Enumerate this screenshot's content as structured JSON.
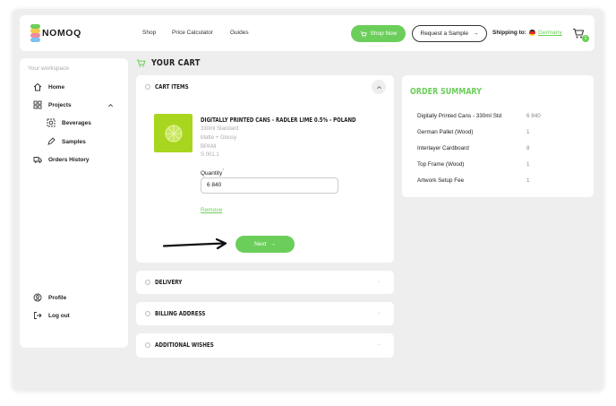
{
  "brand": {
    "name": "NOMOQ"
  },
  "header": {
    "nav": [
      "Shop",
      "Price Calculator",
      "Guides"
    ],
    "shop_now_label": "Shop Now",
    "request_sample_label": "Request a Sample",
    "shipping_label": "Shipping to:",
    "shipping_country": "Germany",
    "cart_count": "1"
  },
  "sidebar": {
    "workspace_label": "Your workspace",
    "items": [
      {
        "label": "Home",
        "icon": "home-icon"
      },
      {
        "label": "Projects",
        "icon": "grid-icon"
      },
      {
        "label": "Beverages",
        "icon": "can-icon"
      },
      {
        "label": "Samples",
        "icon": "pen-icon"
      },
      {
        "label": "Orders History",
        "icon": "truck-icon"
      }
    ],
    "bottom": [
      {
        "label": "Profile",
        "icon": "user-icon"
      },
      {
        "label": "Log out",
        "icon": "logout-icon"
      }
    ]
  },
  "page": {
    "title": "YOUR CART"
  },
  "cart_items": {
    "heading": "CART ITEMS",
    "product": {
      "title": "DIGITALLY PRINTED CANS - RADLER LIME 0.5% - POLAND",
      "lines": [
        "330ml Standard",
        "Matte + Glossy",
        "BPANI",
        "S 001.1"
      ]
    },
    "quantity_label": "Quantity",
    "quantity_value": "6 840",
    "remove_label": "Remove",
    "next_label": "Next"
  },
  "sections": [
    {
      "heading": "DELIVERY"
    },
    {
      "heading": "BILLING ADDRESS"
    },
    {
      "heading": "ADDITIONAL WISHES"
    }
  ],
  "summary": {
    "title": "ORDER SUMMARY",
    "rows": [
      {
        "label": "Digitally Printed Cans - 330ml Std",
        "value": "6 840"
      },
      {
        "label": "German Pallet (Wood)",
        "value": "1"
      },
      {
        "label": "Interlayer Cardboard",
        "value": "8"
      },
      {
        "label": "Top Frame (Wood)",
        "value": "1"
      },
      {
        "label": "Artwork Setup Fee",
        "value": "1"
      }
    ]
  },
  "colors": {
    "accent": "#6cce5a",
    "background": "#eeeeee"
  }
}
